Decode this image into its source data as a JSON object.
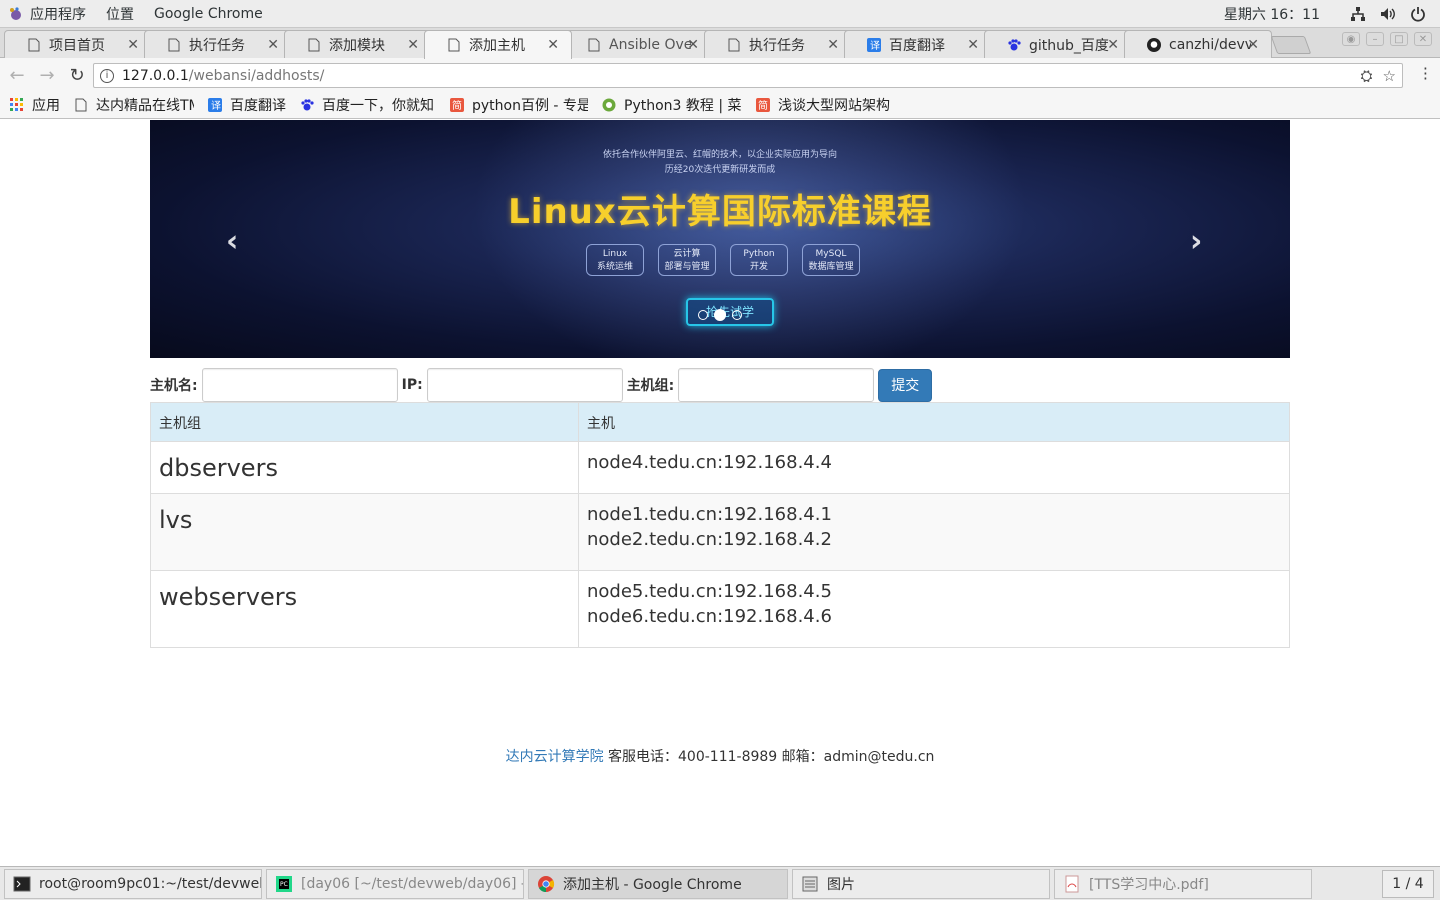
{
  "topbar": {
    "applications": "应用程序",
    "places": "位置",
    "active_app": "Google Chrome",
    "clock": "星期六 16：11"
  },
  "tabs": [
    {
      "label": "项目首页"
    },
    {
      "label": "执行任务"
    },
    {
      "label": "添加模块"
    },
    {
      "label": "添加主机"
    },
    {
      "label": "Ansible Ove"
    },
    {
      "label": "执行任务"
    },
    {
      "label": "百度翻译"
    },
    {
      "label": "github_百度"
    },
    {
      "label": "canzhi/devv"
    }
  ],
  "omnibox": {
    "host": "127.0.0.1",
    "path": "/webansi/addhosts/"
  },
  "bookmarks": [
    {
      "label": "应用"
    },
    {
      "label": "达内精品在线TMO"
    },
    {
      "label": "百度翻译"
    },
    {
      "label": "百度一下，你就知"
    },
    {
      "label": "python百例 - 专是"
    },
    {
      "label": "Python3 教程 | 菜"
    },
    {
      "label": "浅谈大型网站架构"
    }
  ],
  "banner": {
    "sub1": "依托合作伙伴阿里云、红帽的技术，以企业实际应用为导向",
    "sub2": "历经20次迭代更新研发而成",
    "headline": "Linux云计算国际标准课程",
    "badges": [
      {
        "l1": "Linux",
        "l2": "系统运维"
      },
      {
        "l1": "云计算",
        "l2": "部署与管理"
      },
      {
        "l1": "Python",
        "l2": "开发"
      },
      {
        "l1": "MySQL",
        "l2": "数据库管理"
      }
    ],
    "cta": "抢先试学"
  },
  "form": {
    "hostname_label": "主机名:",
    "ip_label": "IP:",
    "group_label": "主机组:",
    "submit_label": "提交"
  },
  "table": {
    "headers": [
      "主机组",
      "主机"
    ],
    "rows": [
      {
        "group": "dbservers",
        "hosts": [
          "node4.tedu.cn:192.168.4.4"
        ]
      },
      {
        "group": "lvs",
        "hosts": [
          "node1.tedu.cn:192.168.4.1",
          "node2.tedu.cn:192.168.4.2"
        ]
      },
      {
        "group": "webservers",
        "hosts": [
          "node5.tedu.cn:192.168.4.5",
          "node6.tedu.cn:192.168.4.6"
        ]
      }
    ]
  },
  "footer": {
    "brand": "达内云计算学院",
    "contact": " 客服电话：400-111-8989 邮箱：admin@tedu.cn"
  },
  "taskbar": {
    "items": [
      {
        "label": "root@room9pc01:~/test/devweb/d..."
      },
      {
        "label": "[day06 [~/test/devweb/day06] - .../..."
      },
      {
        "label": "添加主机 - Google Chrome"
      },
      {
        "label": "图片"
      },
      {
        "label": "[TTS学习中心.pdf]"
      }
    ],
    "workspace": "1 / 4"
  },
  "colors": {
    "primary": "#337ab7",
    "table_header": "#d9edf7",
    "headline": "#f7cf2c"
  }
}
